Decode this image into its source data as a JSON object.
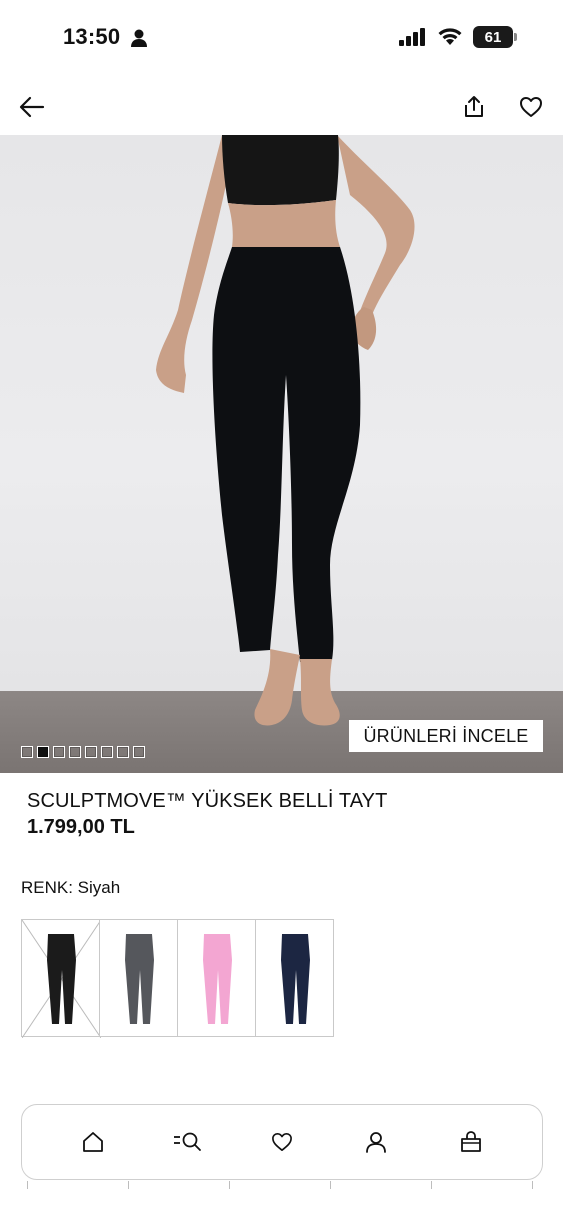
{
  "status_bar": {
    "time": "13:50",
    "battery": "61",
    "icons": [
      "person-icon",
      "signal-icon",
      "wifi-icon",
      "battery-icon"
    ]
  },
  "nav": {
    "icons": [
      "back-arrow-icon",
      "share-icon",
      "heart-icon"
    ]
  },
  "hero": {
    "cta_label": "ÜRÜNLERİ İNCELE",
    "image_count": 8,
    "active_index": 1
  },
  "product": {
    "title": "SCULPTMOVE™ YÜKSEK BELLİ TAYT",
    "price": "1.799,00 TL"
  },
  "colors": {
    "label": "RENK: Siyah",
    "swatches": [
      {
        "name": "black",
        "hex": "#1b1b1b",
        "selected": true
      },
      {
        "name": "dark-grey",
        "hex": "#55575c",
        "selected": false
      },
      {
        "name": "pink",
        "hex": "#f3a6d2",
        "selected": false
      },
      {
        "name": "navy",
        "hex": "#1c2642",
        "selected": false
      }
    ]
  },
  "tabbar": {
    "items": [
      "home-icon",
      "search-icon",
      "heart-icon",
      "account-icon",
      "bag-icon"
    ]
  }
}
